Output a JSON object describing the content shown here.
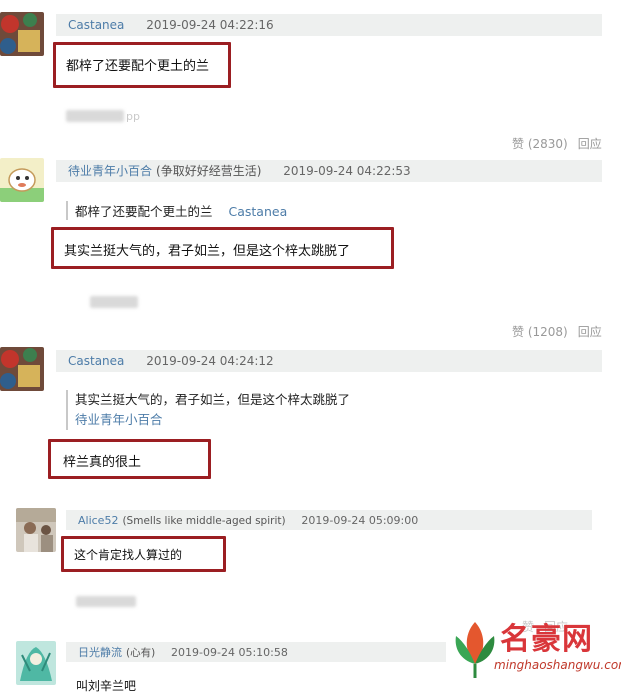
{
  "comments": [
    {
      "user": "Castanea",
      "time": "2019-09-24 04:22:16",
      "text": "都梓了还要配个更土的兰",
      "device_suffix": "pp",
      "votes": "赞 (2830)",
      "reply": "回应"
    },
    {
      "user": "待业青年小百合",
      "tagline": "(争取好好经营生活)",
      "time": "2019-09-24 04:22:53",
      "quote_text": "都梓了还要配个更土的兰",
      "quote_author": "Castanea",
      "text": "其实兰挺大气的，君子如兰，但是这个梓太跳脱了",
      "votes": "赞 (1208)",
      "reply": "回应"
    },
    {
      "user": "Castanea",
      "time": "2019-09-24 04:24:12",
      "quote_text": "其实兰挺大气的，君子如兰，但是这个梓太跳脱了",
      "quote_author": "待业青年小百合",
      "text": "梓兰真的很土"
    },
    {
      "user": "Alice52",
      "tagline": "(Smells like middle-aged spirit)",
      "time": "2019-09-24 05:09:00",
      "text": "这个肯定找人算过的",
      "votes": "赞",
      "reply": "回应"
    },
    {
      "user": "日光静流",
      "tagline": "(心有)",
      "time": "2019-09-24 05:10:58",
      "text": "叫刘辛兰吧"
    }
  ],
  "watermark": {
    "brand": "名豪网",
    "url": "minghaoshangwu.com"
  },
  "colors": {
    "username": "#4d7ca8",
    "highlight_box": "#9b1e22",
    "header_bar": "#eef0ef",
    "meta": "#999999"
  }
}
